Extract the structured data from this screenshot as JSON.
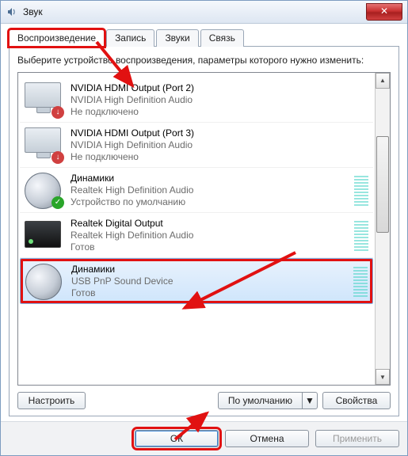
{
  "window": {
    "title": "Звук",
    "close_label": "✕"
  },
  "tabs": {
    "playback": "Воспроизведение",
    "recording": "Запись",
    "sounds": "Звуки",
    "comm": "Связь"
  },
  "instruction": "Выберите устройство воспроизведения, параметры которого нужно изменить:",
  "devices": [
    {
      "name": "NVIDIA HDMI Output (Port 2)",
      "sub": "NVIDIA High Definition Audio",
      "status": "Не подключено",
      "icon": "monitor",
      "badge": "down"
    },
    {
      "name": "NVIDIA HDMI Output (Port 3)",
      "sub": "NVIDIA High Definition Audio",
      "status": "Не подключено",
      "icon": "monitor",
      "badge": "down"
    },
    {
      "name": "Динамики",
      "sub": "Realtek High Definition Audio",
      "status": "Устройство по умолчанию",
      "icon": "speaker",
      "badge": "ok"
    },
    {
      "name": "Realtek Digital Output",
      "sub": "Realtek High Definition Audio",
      "status": "Готов",
      "icon": "spdif",
      "badge": ""
    },
    {
      "name": "Динамики",
      "sub": "USB PnP Sound Device",
      "status": "Готов",
      "icon": "speaker",
      "badge": ""
    }
  ],
  "buttons": {
    "configure": "Настроить",
    "set_default": "По умолчанию",
    "properties": "Свойства",
    "ok": "ОК",
    "cancel": "Отмена",
    "apply": "Применить"
  },
  "icons": {
    "down": "↓",
    "ok": "✓",
    "caret": "▼",
    "up": "▲"
  }
}
